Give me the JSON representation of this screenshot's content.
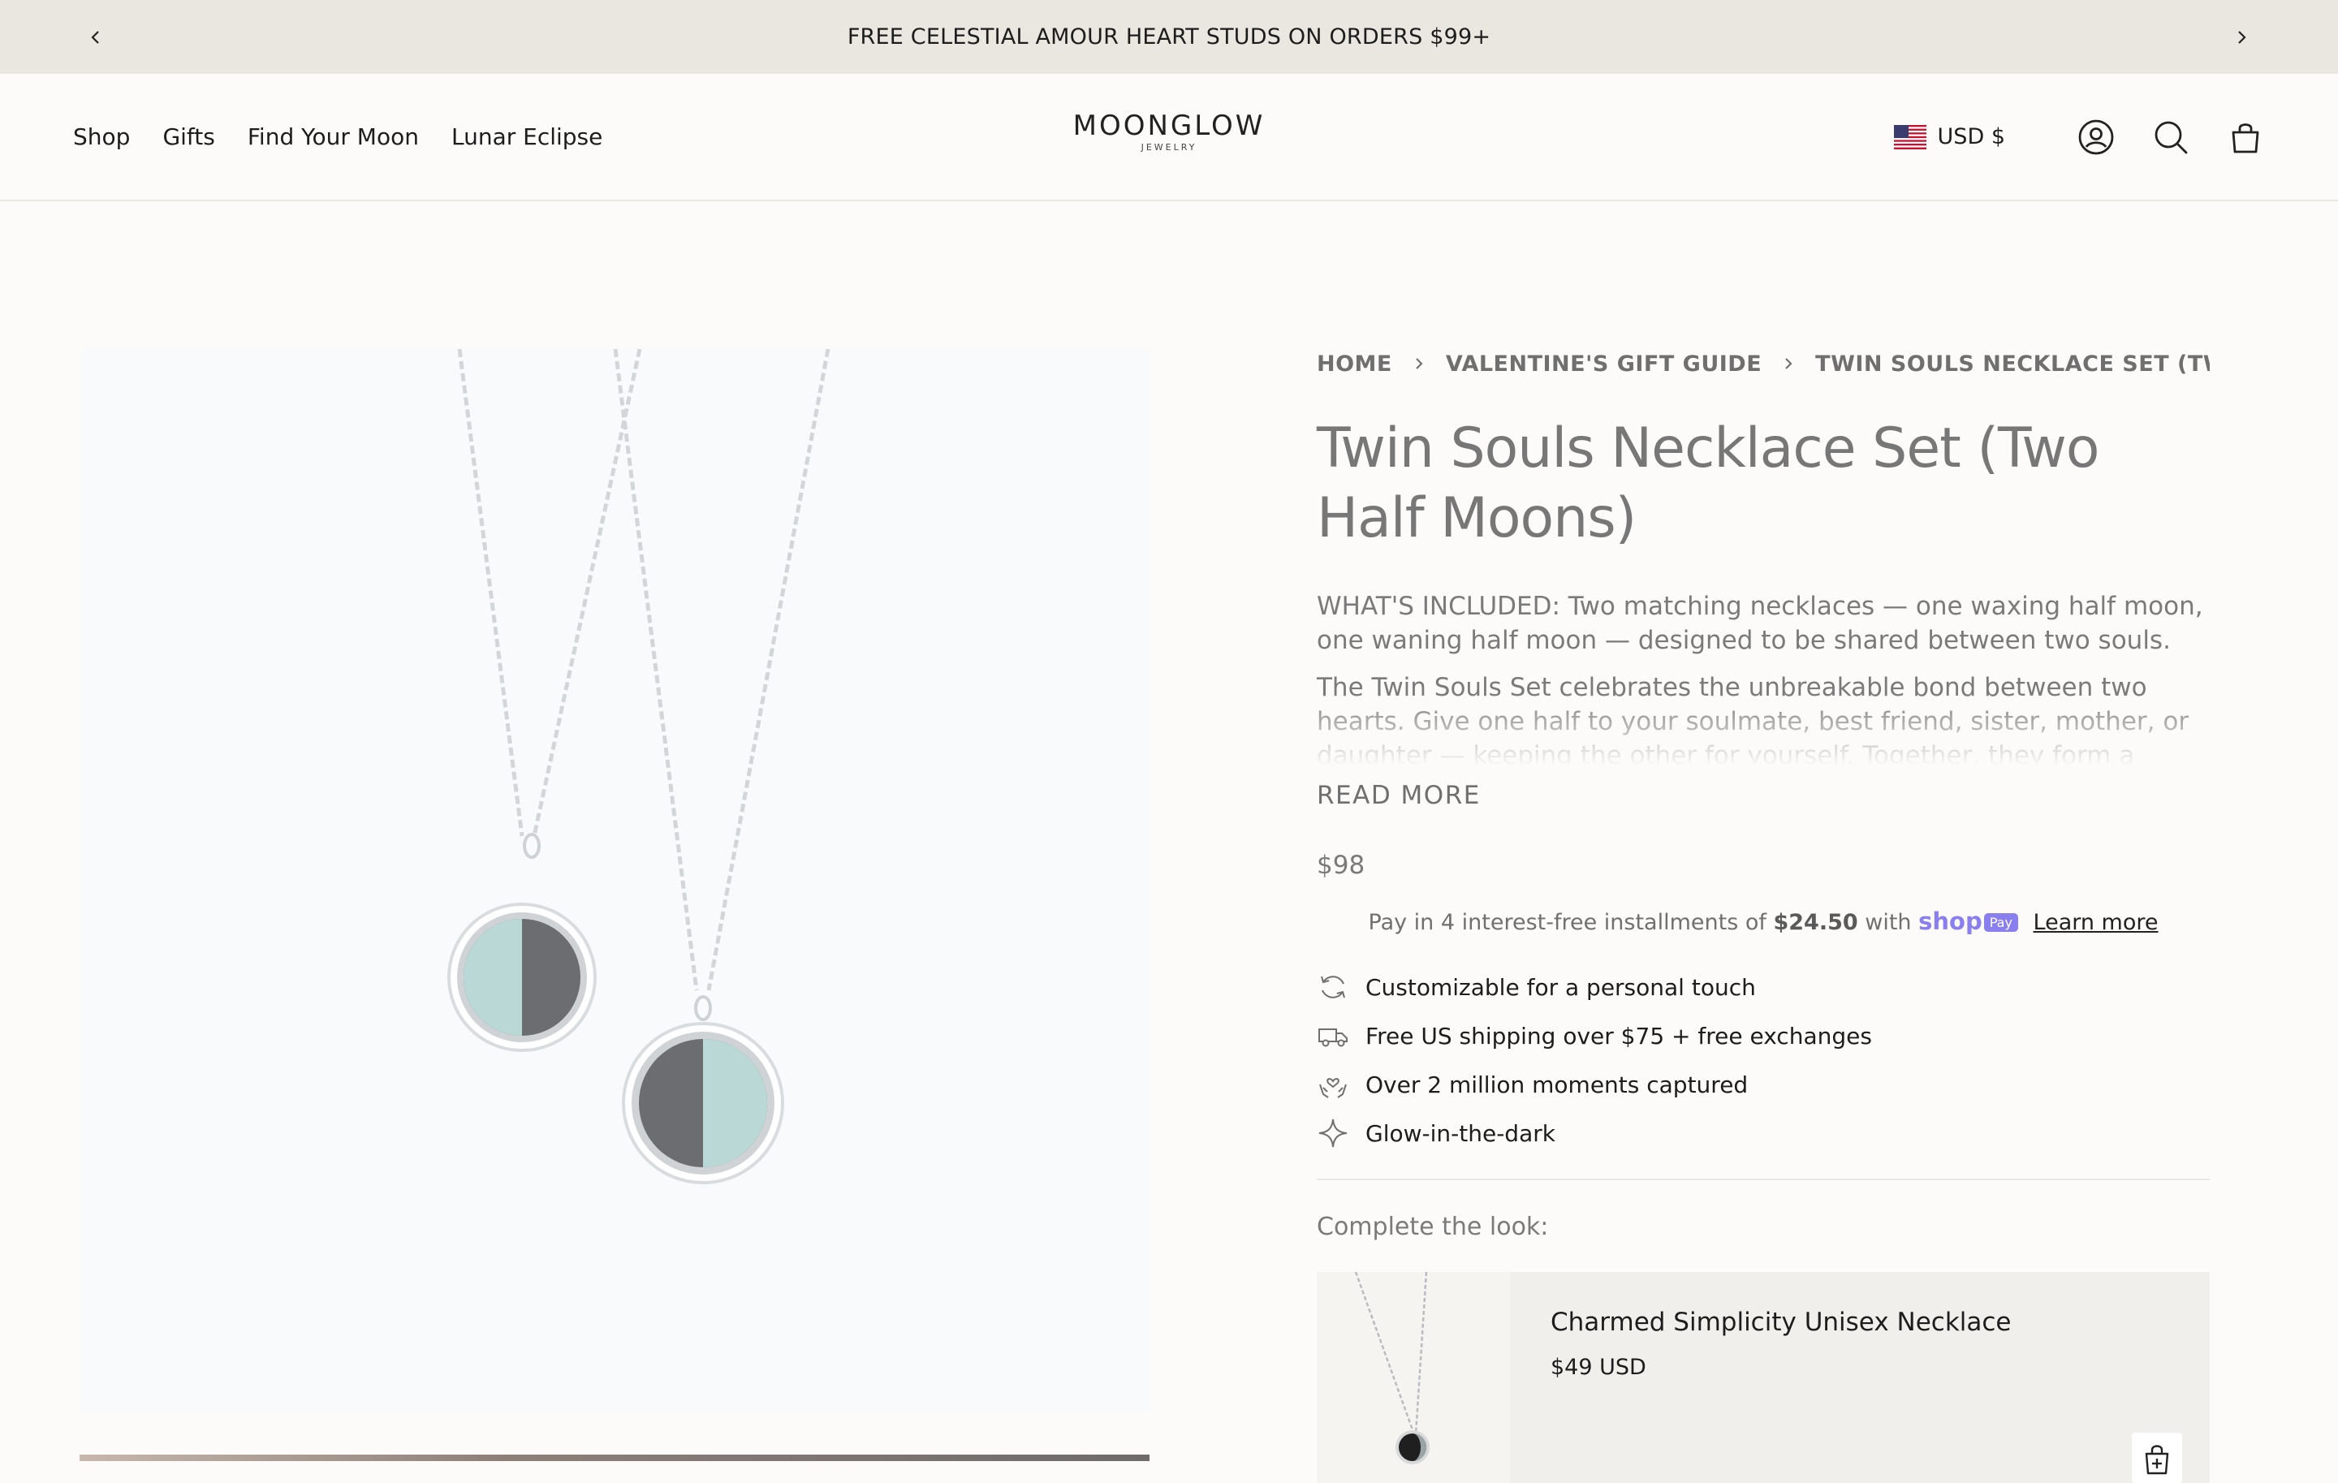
{
  "announcement": {
    "text": "FREE CELESTIAL AMOUR HEART STUDS ON ORDERS $99+"
  },
  "nav": {
    "items": [
      "Shop",
      "Gifts",
      "Find Your Moon",
      "Lunar Eclipse"
    ]
  },
  "logo": {
    "brand": "MOONGLOW",
    "sub": "JEWELRY"
  },
  "header": {
    "currency": "USD $",
    "icons": [
      "us-flag-icon",
      "account-icon",
      "search-icon",
      "cart-icon"
    ]
  },
  "breadcrumb": {
    "items": [
      "HOME",
      "VALENTINE'S GIFT GUIDE",
      "TWIN SOULS NECKLACE SET (TWO HALF MOONS)"
    ]
  },
  "product": {
    "title": "Twin Souls Necklace Set (Two Half Moons)",
    "desc_label": "WHAT'S INCLUDED:",
    "desc_included": " Two matching necklaces — one waxing half moon, one waning half moon — designed to be shared between two souls.",
    "desc_body": "The Twin Souls Set celebrates the unbreakable bond between two hearts. Give one half to your soulmate, best friend, sister, mother, or daughter — keeping the other for yourself. Together, they form a complete moon, symbolizing how two people make each other whole.",
    "read_more": "READ MORE",
    "price": "$98"
  },
  "shoppay": {
    "prefix": "Pay in 4 interest-free installments of ",
    "amount": "$24.50",
    "with": " with ",
    "logo": "shop",
    "pay": "Pay",
    "learn_more": "Learn more"
  },
  "features": [
    {
      "icon": "refresh-icon",
      "text": "Customizable for a personal touch"
    },
    {
      "icon": "truck-icon",
      "text": "Free US shipping over $75 + free exchanges"
    },
    {
      "icon": "hands-heart-icon",
      "text": "Over 2 million moments captured"
    },
    {
      "icon": "sparkle-icon",
      "text": "Glow-in-the-dark"
    }
  ],
  "complete_look": {
    "heading": "Complete the look:",
    "item_name": "Charmed Simplicity Unisex Necklace",
    "item_price": "$49 USD"
  },
  "colors": {
    "announcement_bg": "#eae7e1",
    "page_bg": "#fcfbf9",
    "shoppay": "#8a7fef",
    "card_bg": "#f1efeb"
  }
}
